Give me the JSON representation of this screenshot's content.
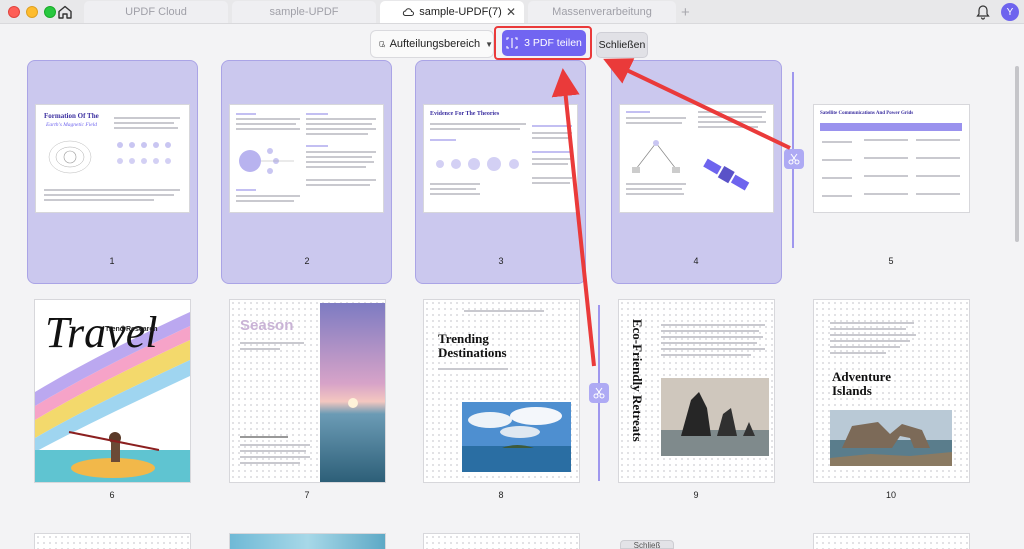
{
  "tabs": [
    {
      "label": "UPDF Cloud"
    },
    {
      "label": "sample-UPDF"
    },
    {
      "label": "sample-UPDF(7)"
    },
    {
      "label": "Massenverarbeitung"
    }
  ],
  "avatar_initial": "Y",
  "toolbar": {
    "split_area_label": "Aufteilungsbereich",
    "split_pdf_label": "3 PDF teilen",
    "close_label": "Schließen"
  },
  "pages": [
    {
      "number": "1",
      "title": "Formation Of The",
      "subtitle": "Earth's Magnetic Field"
    },
    {
      "number": "2"
    },
    {
      "number": "3",
      "title": "Evidence For The Theories"
    },
    {
      "number": "4"
    },
    {
      "number": "5",
      "title": "Satellite Communications And Power Grids"
    },
    {
      "number": "6",
      "title": "Travel",
      "subtitle": "Trend Research"
    },
    {
      "number": "7",
      "title": "Season"
    },
    {
      "number": "8",
      "title": "Trending Destinations"
    },
    {
      "number": "9",
      "title": "Eco-Friendly Retreats"
    },
    {
      "number": "10",
      "title": "Adventure Islands"
    }
  ],
  "bottom_pill_label": "Schließ",
  "colors": {
    "accent": "#7165f1",
    "selection": "#cbc8ee",
    "highlight": "#ea3a3a"
  }
}
